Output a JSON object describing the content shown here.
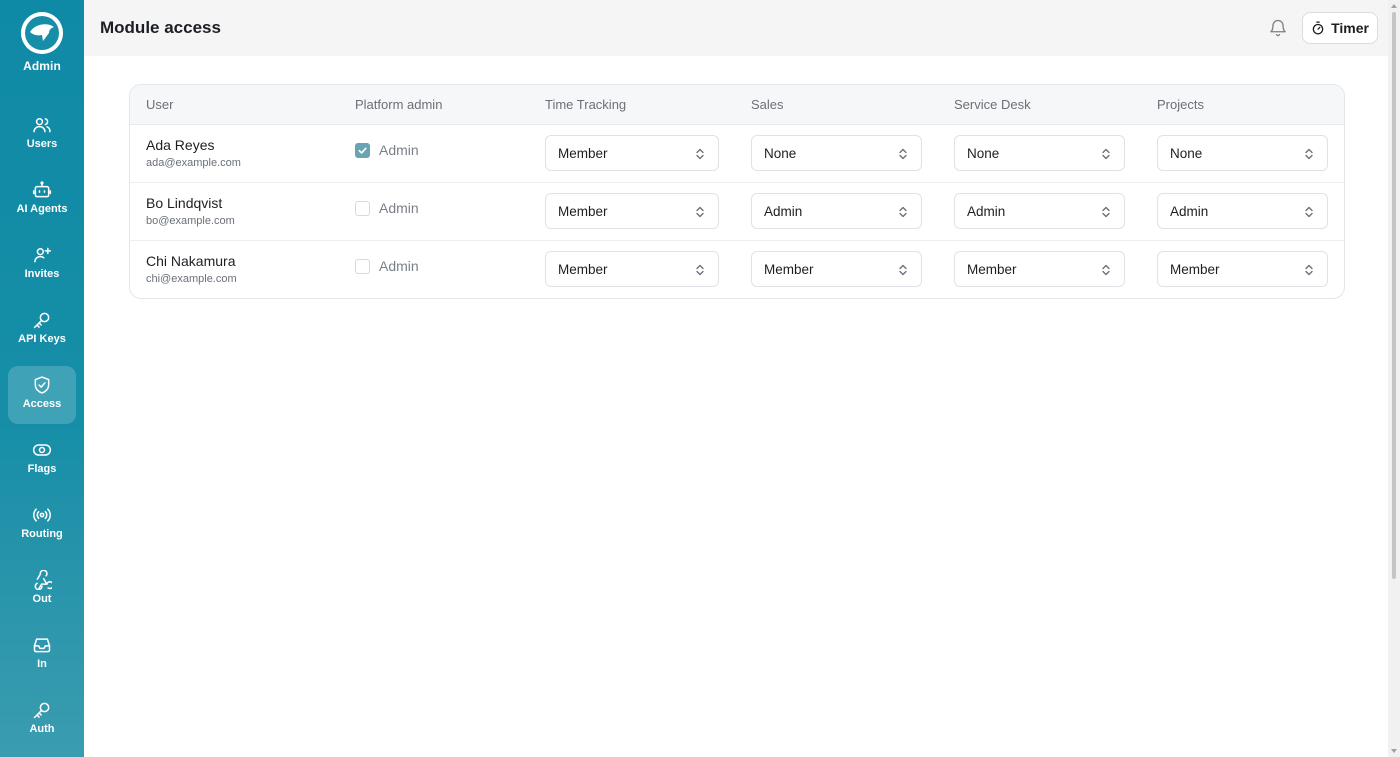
{
  "sidebar": {
    "brand_label": "Admin",
    "brand_sub": "",
    "items": [
      {
        "label": "Users",
        "icon": "users-icon"
      },
      {
        "label": "AI Agents",
        "icon": "robot-icon"
      },
      {
        "label": "Invites",
        "icon": "user-plus-icon"
      },
      {
        "label": "API Keys",
        "icon": "key-icon"
      },
      {
        "label": "Access",
        "icon": "shield-check-icon",
        "active": true
      },
      {
        "label": "Flags",
        "icon": "toggle-icon"
      },
      {
        "label": "Routing",
        "icon": "broadcast-icon"
      },
      {
        "label": "Out",
        "icon": "webhook-icon"
      },
      {
        "label": "In",
        "icon": "inbox-icon"
      },
      {
        "label": "Auth",
        "icon": "key-icon"
      }
    ]
  },
  "header": {
    "title": "Module access",
    "timer_label": "Timer"
  },
  "table": {
    "columns": [
      "User",
      "Platform admin",
      "Time Tracking",
      "Sales",
      "Service Desk",
      "Projects"
    ],
    "rows": [
      {
        "name": "Ada Reyes",
        "email": "ada@example.com",
        "admin_label": "Admin",
        "platform_admin": true,
        "time_tracking": "Member",
        "sales": "None",
        "service_desk": "None",
        "projects": "None"
      },
      {
        "name": "Bo Lindqvist",
        "email": "bo@example.com",
        "admin_label": "Admin",
        "platform_admin": false,
        "time_tracking": "Member",
        "sales": "Admin",
        "service_desk": "Admin",
        "projects": "Admin"
      },
      {
        "name": "Chi Nakamura",
        "email": "chi@example.com",
        "admin_label": "Admin",
        "platform_admin": false,
        "time_tracking": "Member",
        "sales": "Member",
        "service_desk": "Member",
        "projects": "Member"
      }
    ]
  },
  "colors": {
    "sidebar": "#168ea7",
    "checkbox_checked": "#6aa3b4"
  }
}
